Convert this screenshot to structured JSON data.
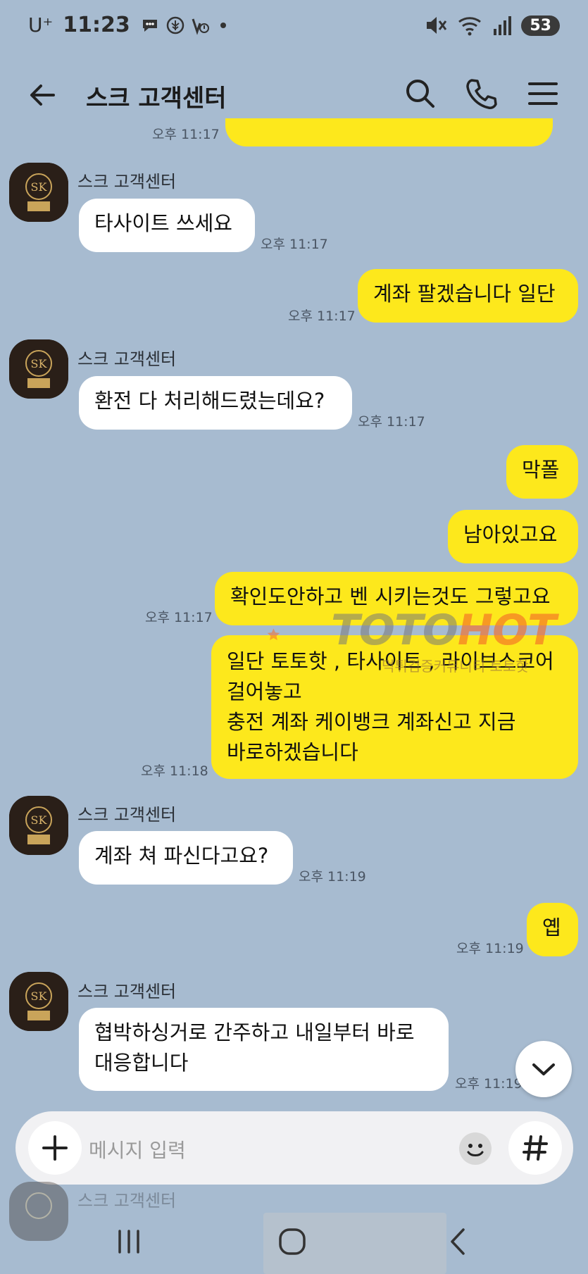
{
  "status_bar": {
    "carrier": "U⁺",
    "time": "11:23",
    "battery": "53"
  },
  "app_bar": {
    "title": "스크 고객센터"
  },
  "top_partial": {
    "time": "오후 11:17"
  },
  "messages": [
    {
      "side": "in",
      "sender": "스크 고객센터",
      "text": "타사이트 쓰세요",
      "time": "오후 11:17"
    },
    {
      "side": "out",
      "text": "계좌 팔겠습니다 일단",
      "time": "오후 11:17"
    },
    {
      "side": "in",
      "sender": "스크 고객센터",
      "text": "환전 다 처리해드렸는데요?",
      "time": "오후 11:17"
    },
    {
      "side": "out",
      "text": "막폴"
    },
    {
      "side": "out",
      "text": "남아있고요"
    },
    {
      "side": "out",
      "text": "확인도안하고 벤 시키는것도 그렇고요",
      "time": "오후 11:17"
    },
    {
      "side": "out",
      "lines": [
        "일단 토토핫 , 타사이트 , 라이브스코어",
        "걸어놓고",
        "충전 계좌 케이뱅크 계좌신고 지금",
        "바로하겠습니다"
      ],
      "time": "오후 11:18"
    },
    {
      "side": "in",
      "sender": "스크 고객센터",
      "text": "계좌 쳐 파신다고요?",
      "time": "오후 11:19"
    },
    {
      "side": "out",
      "text": "옙",
      "time": "오후 11:19"
    },
    {
      "side": "in",
      "sender": "스크 고객센터",
      "lines": [
        "협박하싱거로 간주하고 내일부터 바로",
        "대응합니다"
      ],
      "time": "오후 11:19"
    }
  ],
  "watermark": {
    "brand_a": "TOTO",
    "brand_b": "HOT",
    "sub": "먹튀검증커뮤니티 토토핫"
  },
  "avatar_text": "스크",
  "input": {
    "placeholder": "메시지 입력"
  },
  "below_sender": "스크 고객센터",
  "colors": {
    "background": "#a7bbd0",
    "out_bubble": "#fde81c",
    "in_bubble": "#ffffff"
  }
}
